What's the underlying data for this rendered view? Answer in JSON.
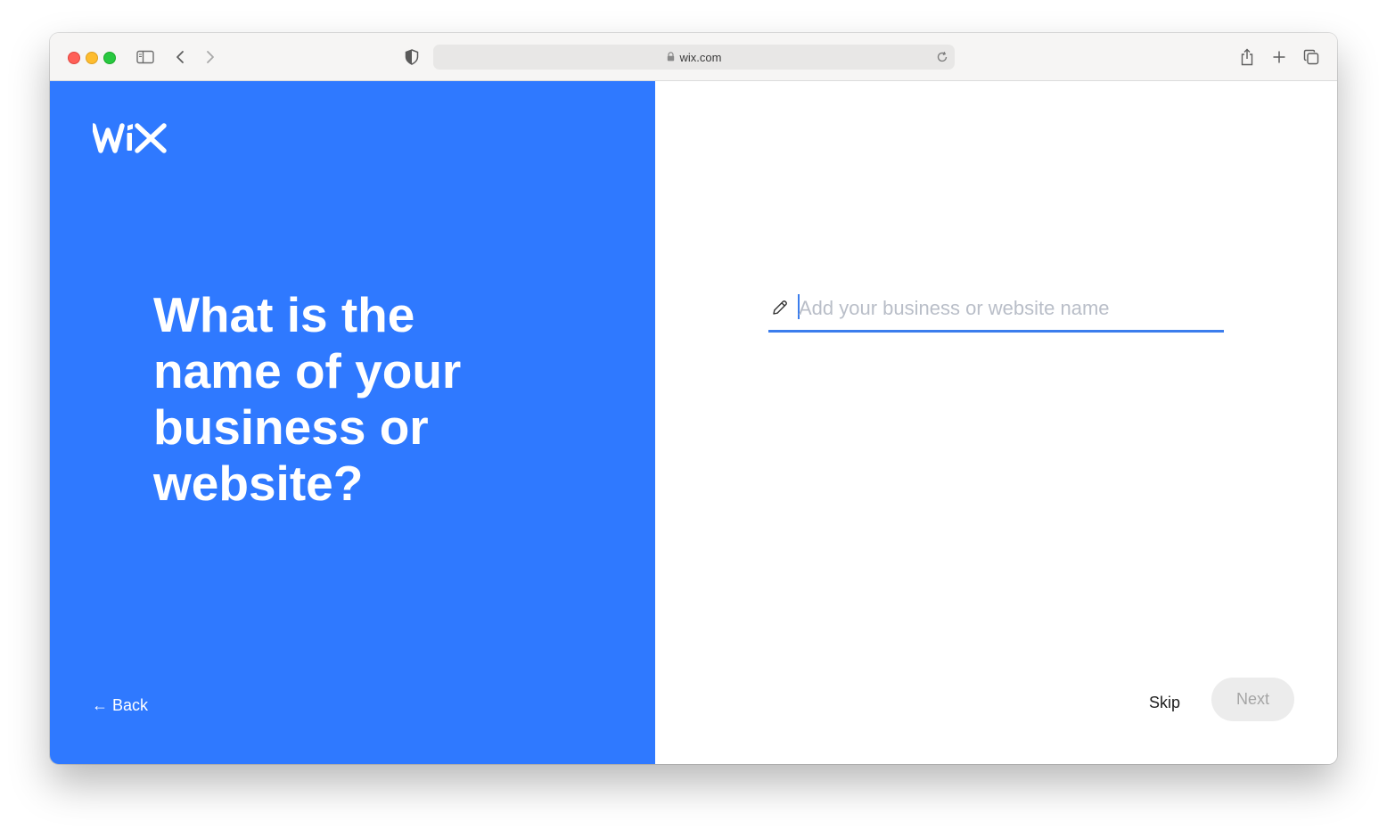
{
  "browser": {
    "url": "wix.com",
    "icons": {
      "sidebar": "sidebar-toggle-icon",
      "back": "chevron-left-icon",
      "forward": "chevron-right-icon",
      "privacy": "shield-icon",
      "lock": "lock-icon",
      "reload": "reload-icon",
      "share": "share-icon",
      "new_tab": "plus-icon",
      "tabs": "tab-overview-icon"
    }
  },
  "brand": {
    "logo_text": "WiX",
    "accent_color": "#2f79ff",
    "input_underline_color": "#3b7ded"
  },
  "onboarding": {
    "question": "What is the name of your business or website?",
    "back_label": "← Back",
    "input": {
      "value": "",
      "placeholder": "Add your business or website name"
    },
    "skip_label": "Skip",
    "next_label": "Next",
    "next_disabled": true
  }
}
